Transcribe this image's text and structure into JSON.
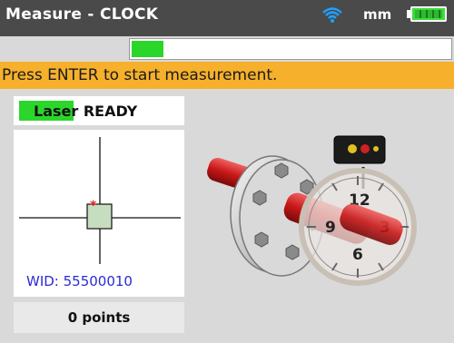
{
  "titlebar": {
    "title": "Measure - CLOCK",
    "unit": "mm",
    "wifi_icon": "wifi-icon",
    "battery_icon": "battery-icon"
  },
  "progress": {
    "fraction": 0.1
  },
  "instruction": "Press ENTER to start measurement.",
  "laser": {
    "label_bold_part": "Laser",
    "status": "READY",
    "full_label": "Laser READY"
  },
  "target": {
    "wid": "WID: 55500010"
  },
  "points": "0 points",
  "clock_dial": {
    "labels": [
      "12",
      "3",
      "6",
      "9"
    ]
  },
  "colors": {
    "titlebar": "#4a4a4a",
    "instruction_bar": "#f6b02b",
    "accent_green": "#2bd62b",
    "wid_blue": "#2a2ad6",
    "laser_marker_red": "#e02020"
  }
}
